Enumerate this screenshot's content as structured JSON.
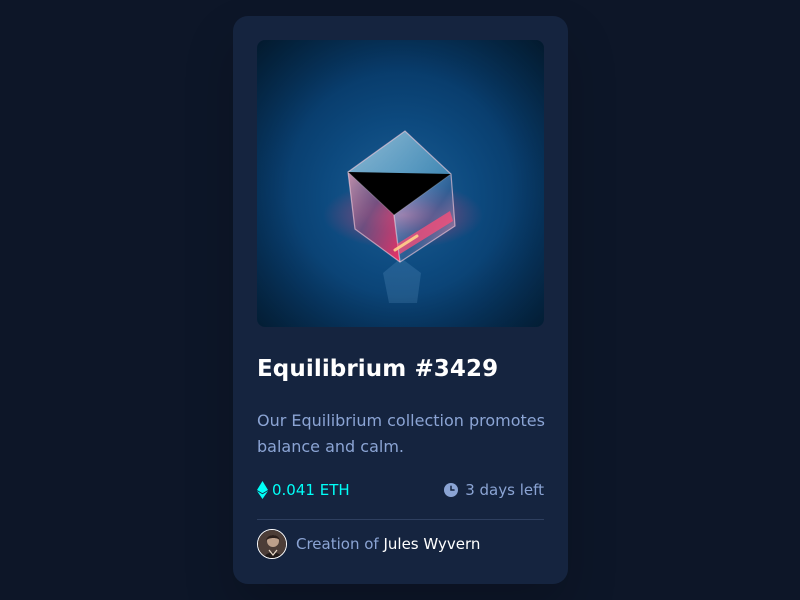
{
  "card": {
    "image_alt": "Equilibrium crystal cube",
    "title": "Equilibrium #3429",
    "description": "Our Equilibrium collection promotes balance and calm.",
    "price": "0.041 ETH",
    "time_left": "3 days left",
    "creator_prefix": "Creation of",
    "creator_name": "Jules Wyvern"
  },
  "icons": {
    "price": "ethereum-icon",
    "time": "clock-icon",
    "creator": "avatar"
  },
  "colors": {
    "background": "#0d1628",
    "card": "#15243f",
    "accent": "#00fff8",
    "text_muted": "#8ba4d4",
    "text_white": "#ffffff",
    "divider": "#2e3f5f"
  }
}
